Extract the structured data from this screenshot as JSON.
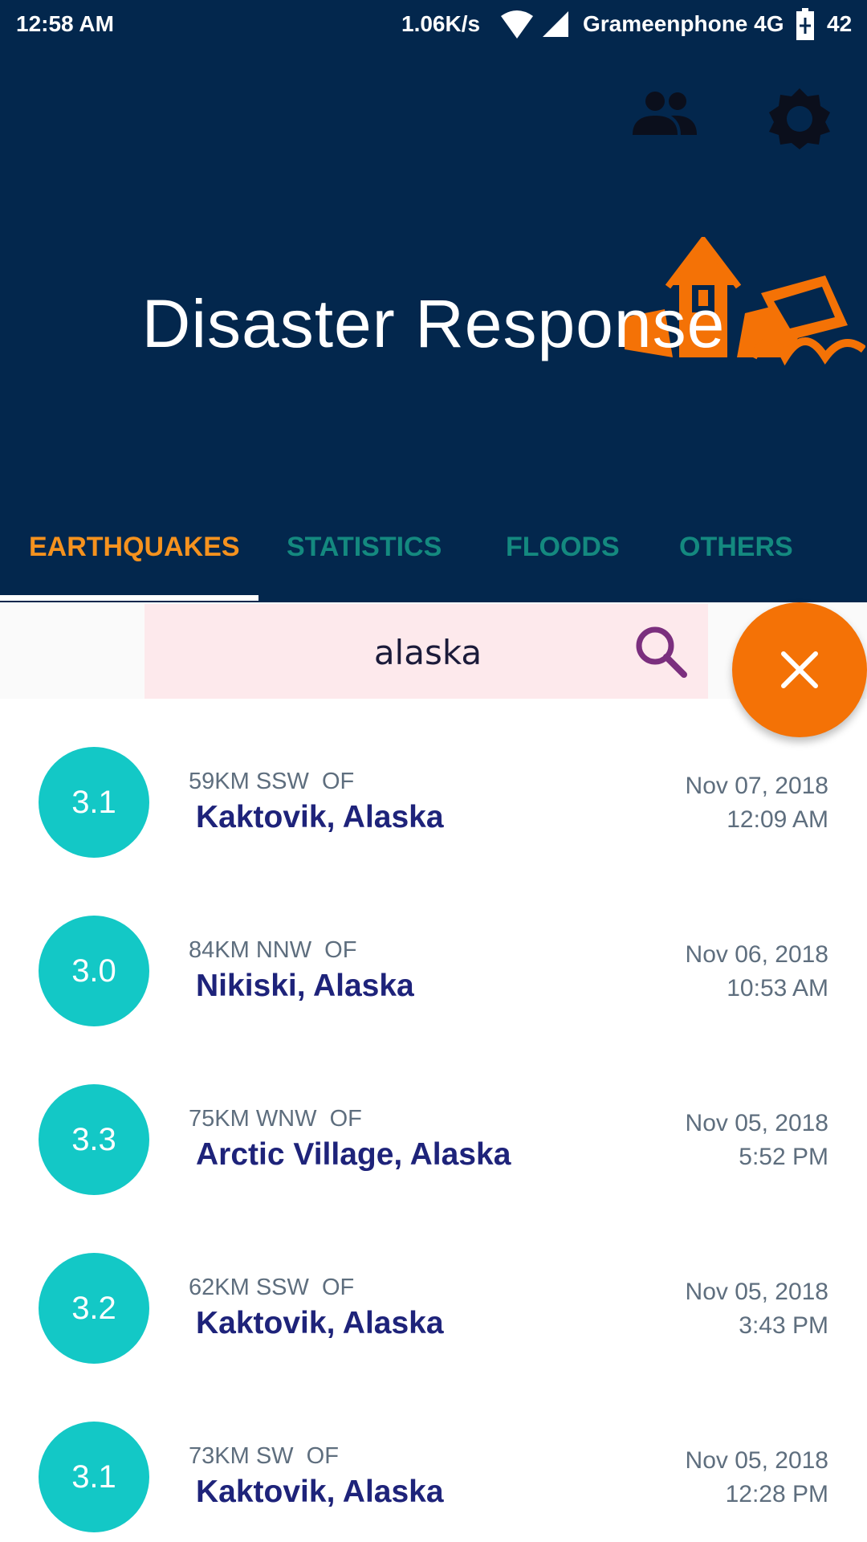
{
  "status_bar": {
    "time": "12:58 AM",
    "speed": "1.06K/s",
    "carrier": "Grameenphone 4G",
    "battery": "42"
  },
  "header": {
    "title": "Disaster Response",
    "icons": [
      "people-icon",
      "settings-icon"
    ],
    "background_color": "#03274d",
    "art_color": "#f47206"
  },
  "tabs": [
    {
      "label": "EARTHQUAKES",
      "active": true
    },
    {
      "label": "STATISTICS",
      "active": false
    },
    {
      "label": "FLOODS",
      "active": false
    },
    {
      "label": "OTHERS",
      "active": false
    }
  ],
  "search": {
    "value": "alaska"
  },
  "fab": {
    "icon": "close-icon",
    "color": "#f47206"
  },
  "earthquakes": [
    {
      "magnitude": "3.1",
      "distance": "59KM SSW  OF",
      "place": "Kaktovik, Alaska",
      "date": "Nov 07, 2018",
      "time": "12:09 AM"
    },
    {
      "magnitude": "3.0",
      "distance": "84KM NNW  OF",
      "place": "Nikiski, Alaska",
      "date": "Nov 06, 2018",
      "time": "10:53 AM"
    },
    {
      "magnitude": "3.3",
      "distance": "75KM WNW  OF",
      "place": "Arctic Village, Alaska",
      "date": "Nov 05, 2018",
      "time": "5:52 PM"
    },
    {
      "magnitude": "3.2",
      "distance": "62KM SSW  OF",
      "place": "Kaktovik, Alaska",
      "date": "Nov 05, 2018",
      "time": "3:43 PM"
    },
    {
      "magnitude": "3.1",
      "distance": "73KM SW  OF",
      "place": "Kaktovik, Alaska",
      "date": "Nov 05, 2018",
      "time": "12:28 PM"
    }
  ]
}
